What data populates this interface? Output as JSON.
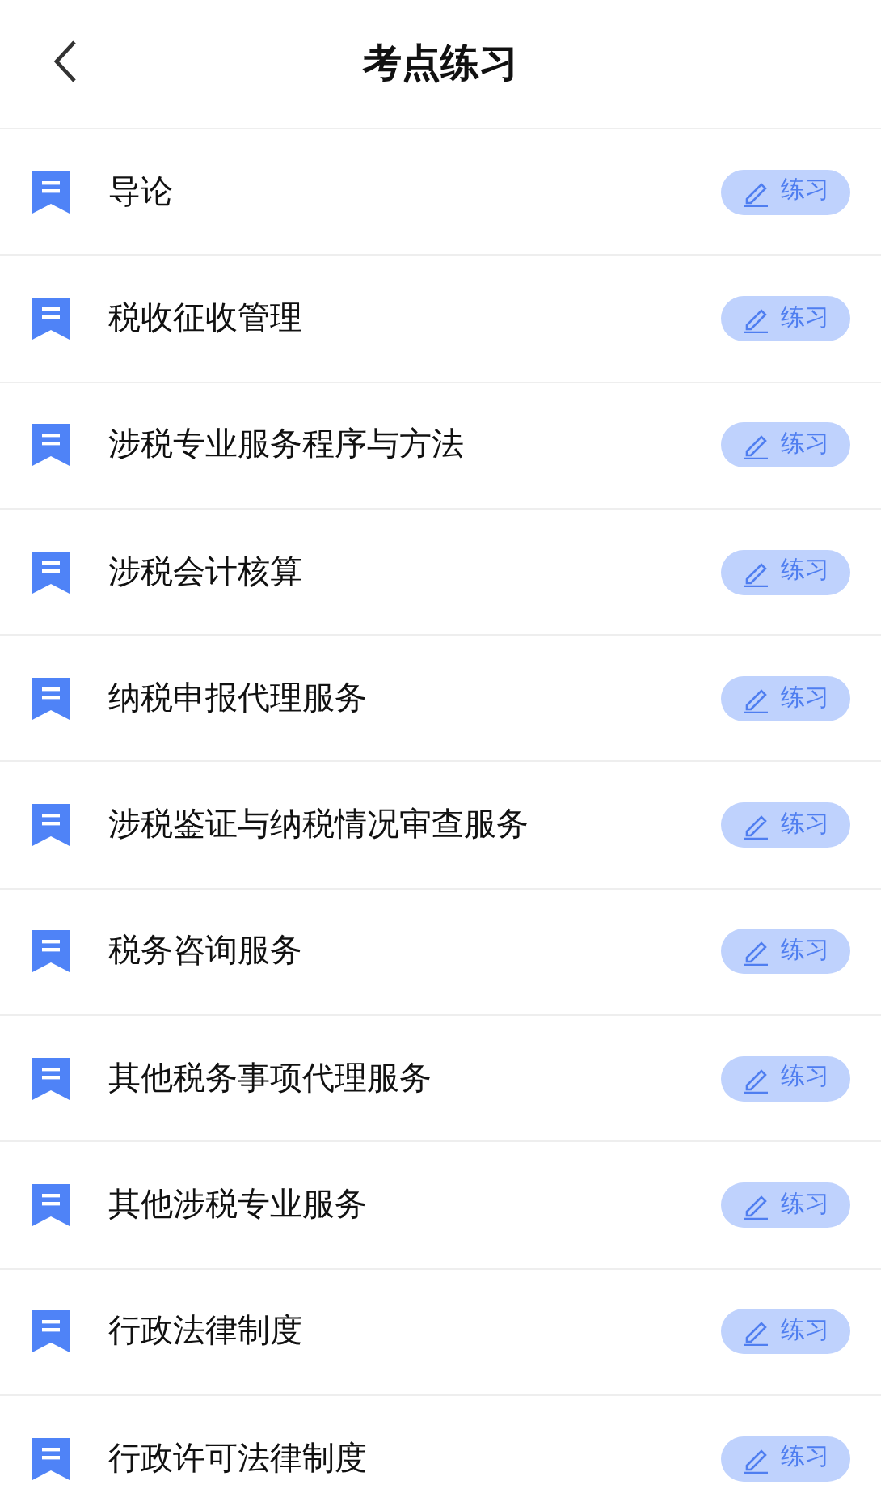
{
  "header": {
    "title": "考点练习"
  },
  "items": [
    {
      "title": "导论",
      "button": "练习"
    },
    {
      "title": "税收征收管理",
      "button": "练习"
    },
    {
      "title": "涉税专业服务程序与方法",
      "button": "练习"
    },
    {
      "title": "涉税会计核算",
      "button": "练习"
    },
    {
      "title": "纳税申报代理服务",
      "button": "练习"
    },
    {
      "title": "涉税鉴证与纳税情况审查服务",
      "button": "练习"
    },
    {
      "title": "税务咨询服务",
      "button": "练习"
    },
    {
      "title": "其他税务事项代理服务",
      "button": "练习"
    },
    {
      "title": "其他涉税专业服务",
      "button": "练习"
    },
    {
      "title": "行政法律制度",
      "button": "练习"
    },
    {
      "title": "行政许可法律制度",
      "button": "练习"
    }
  ]
}
